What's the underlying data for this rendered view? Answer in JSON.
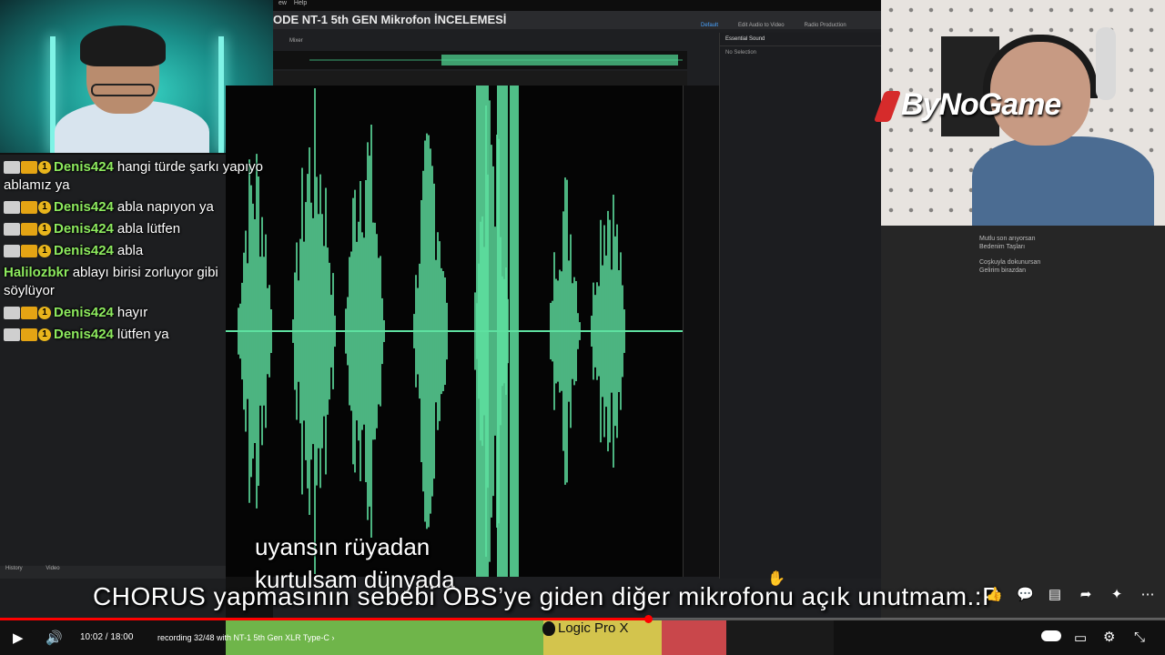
{
  "editor": {
    "menu": [
      "ew",
      "Help"
    ],
    "title": "ODE NT-1 5th GEN Mikrofon İNCELEMESİ",
    "workspace_tabs": [
      "Default",
      "Edit Audio to Video",
      "Radio Production"
    ],
    "panel_title": "Essential Sound",
    "panel_status": "No Selection",
    "mixer_tab": "Mixer"
  },
  "chat": [
    {
      "user": "Denis424",
      "text": "hangi türde şarkı yapıyo ablamız ya",
      "badges": true
    },
    {
      "user": "Denis424",
      "text": "abla napıyon ya",
      "badges": true
    },
    {
      "user": "Denis424",
      "text": "abla lütfen",
      "badges": true
    },
    {
      "user": "Denis424",
      "text": "abla",
      "badges": true
    },
    {
      "user": "Halilozbkr",
      "text": "ablayı birisi zorluyor gibi söylüyor",
      "badges": false
    },
    {
      "user": "Denis424",
      "text": "hayır",
      "badges": true
    },
    {
      "user": "Denis424",
      "text": "lütfen ya",
      "badges": true
    }
  ],
  "badge_number": "1",
  "brand": "ByNoGame",
  "lyrics_panel": [
    "Mutlu son arıyorsan",
    "Bedenim Taşları",
    "Coşkuyla dokunursan",
    "Gelirim birazdan"
  ],
  "history": {
    "tab1": "History",
    "tab2": "Video"
  },
  "subtitles": {
    "line1": "uyansın rüyadan",
    "line2": "kurtulsam dünyada"
  },
  "caption": "CHORUS yapmasının sebebi OBS’ye giden diğer mikrofonu açık unutmam.:P",
  "logic_label": "Logic Pro X",
  "player": {
    "current_time": "10:02",
    "duration": "18:00",
    "time_sep": " / ",
    "chapter": "recording 32/48 with NT-1 5th Gen XLR Type-C",
    "chapter_arrow": "›",
    "progress": 0.557
  },
  "colors": {
    "waveform": "#5ee0a0",
    "accent": "#ff0000",
    "username": "#8dea5e"
  },
  "strip": [
    {
      "color": "#6fb54a",
      "flex": 348
    },
    {
      "color": "#d3c44d",
      "flex": 130
    },
    {
      "color": "#c9474b",
      "flex": 70
    },
    {
      "color": "#1a1a1a",
      "flex": 118
    }
  ]
}
